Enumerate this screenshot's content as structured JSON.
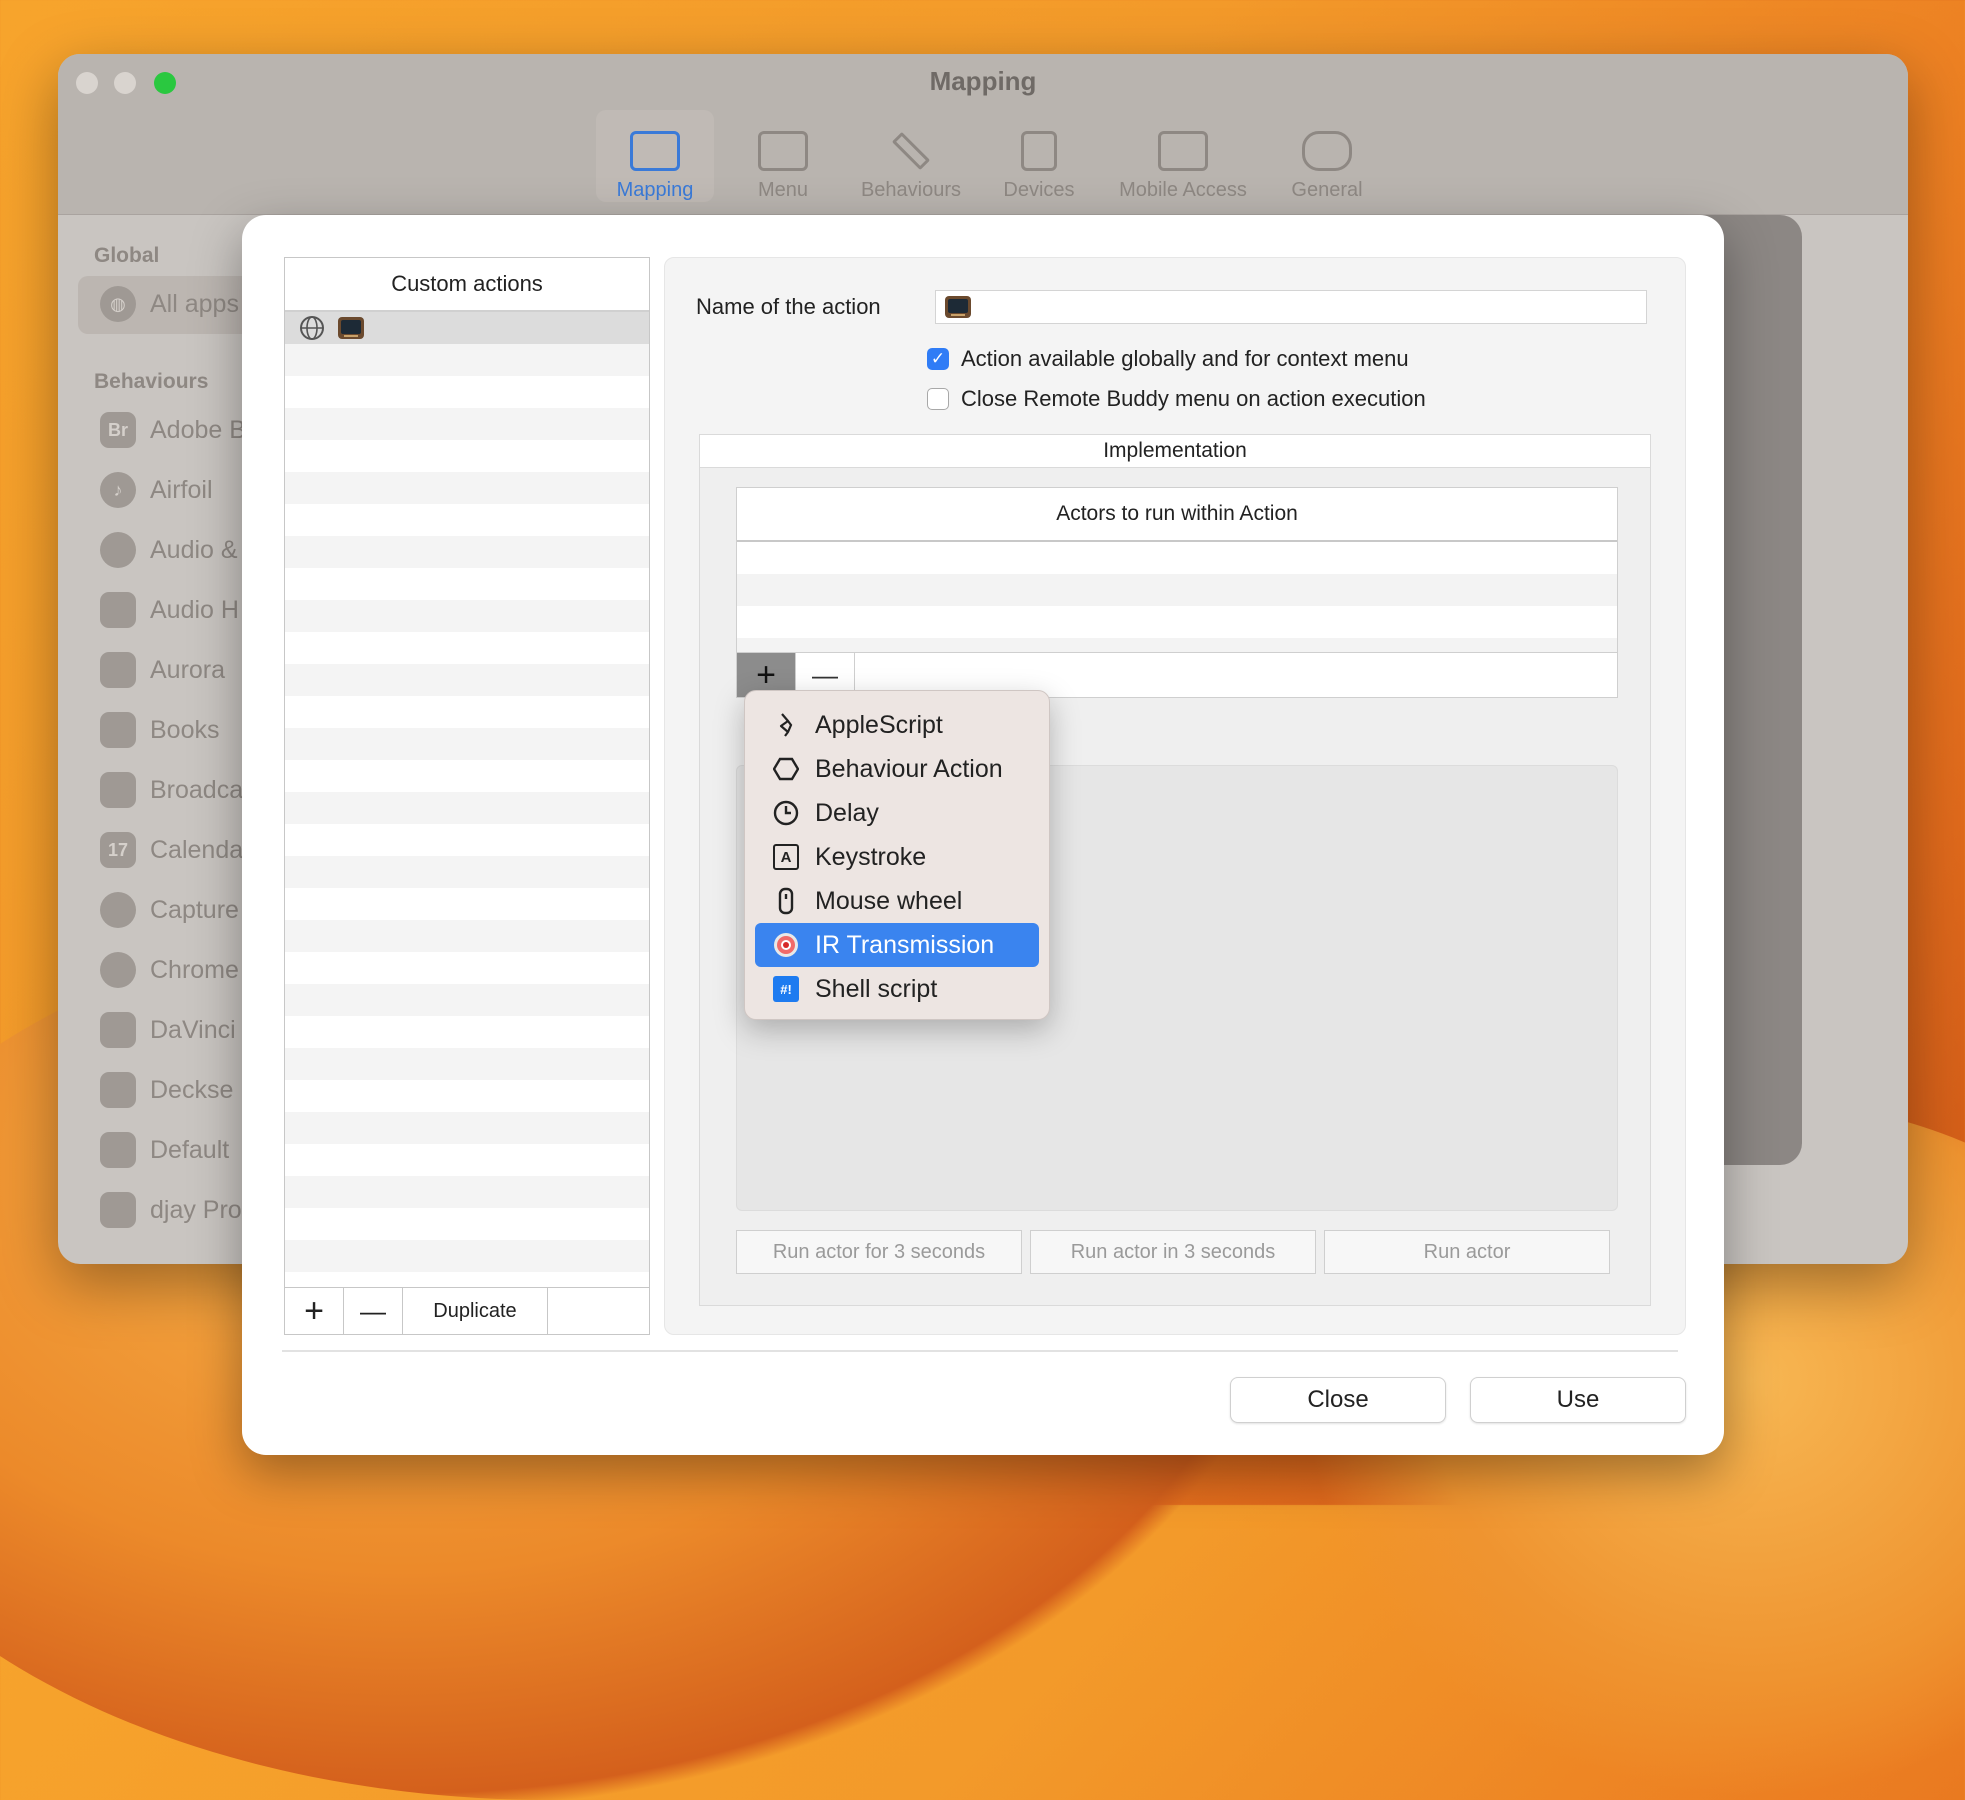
{
  "window": {
    "title": "Mapping",
    "toolbar": [
      "Mapping",
      "Menu",
      "Behaviours",
      "Devices",
      "Mobile Access",
      "General"
    ],
    "sidebar": {
      "global_header": "Global",
      "all_apps": "All apps",
      "behaviours_header": "Behaviours",
      "items": [
        "Adobe B",
        "Airfoil",
        "Audio &",
        "Audio H",
        "Aurora",
        "Books",
        "Broadca",
        "Calenda",
        "Capture",
        "Chrome",
        "DaVinci",
        "Deckse",
        "Default",
        "djay Pro"
      ]
    }
  },
  "custom_actions": {
    "header": "Custom actions",
    "add": "+",
    "remove": "—",
    "duplicate": "Duplicate"
  },
  "detail": {
    "name_label": "Name of the action",
    "checkbox_global": "Action available globally and for context menu",
    "checkbox_global_checked": true,
    "checkbox_close": "Close Remote Buddy menu on action execution",
    "checkbox_close_checked": false,
    "implementation_title": "Implementation",
    "actors_header": "Actors to run within Action",
    "add": "+",
    "remove": "—",
    "run_for": "Run actor for 3 seconds",
    "run_in": "Run actor in 3 seconds",
    "run": "Run actor"
  },
  "menu": {
    "items": [
      {
        "label": "AppleScript",
        "icon": "applescript-icon"
      },
      {
        "label": "Behaviour Action",
        "icon": "hexagon-icon"
      },
      {
        "label": "Delay",
        "icon": "clock-icon"
      },
      {
        "label": "Keystroke",
        "icon": "keystroke-icon",
        "glyph": "A"
      },
      {
        "label": "Mouse wheel",
        "icon": "mouse-icon"
      },
      {
        "label": "IR Transmission",
        "icon": "ir-icon",
        "selected": true
      },
      {
        "label": "Shell script",
        "icon": "shell-icon",
        "glyph": "#!"
      }
    ]
  },
  "buttons": {
    "close": "Close",
    "use": "Use"
  }
}
